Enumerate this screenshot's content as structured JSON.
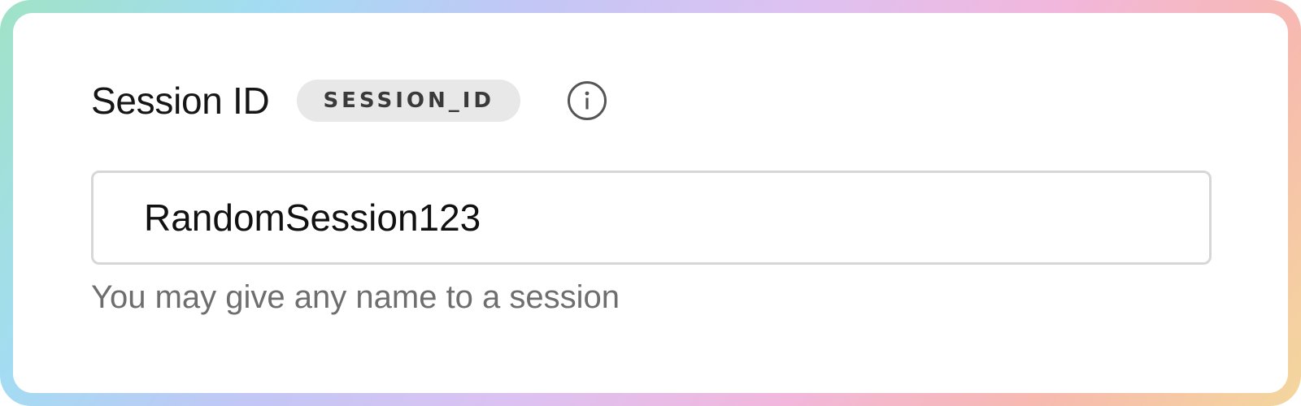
{
  "session_field": {
    "label": "Session ID",
    "badge": "SESSION_ID",
    "info_icon": "info-icon",
    "value": "RandomSession123",
    "placeholder": "",
    "helper_text": "You may give any name to a session"
  },
  "colors": {
    "frame_gradient": [
      "#9fe3c6",
      "#a3dcf3",
      "#c2c7f5",
      "#dcc2f2",
      "#f2b7dc",
      "#f7b9b0",
      "#f4d79c"
    ],
    "badge_background": "#e8e8e8",
    "input_border": "#d7d7d7",
    "helper_text": "#6e6e6e"
  }
}
